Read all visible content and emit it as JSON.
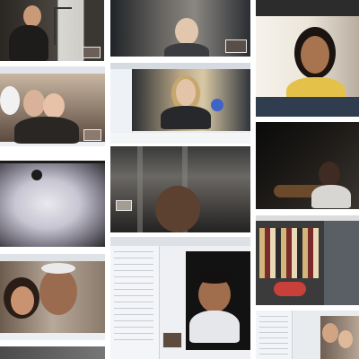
{
  "collage": {
    "tiles": [
      {
        "name": "tile-boy-whiteboard-call"
      },
      {
        "name": "tile-woman-dark-room-call"
      },
      {
        "name": "tile-woman-headphones-call"
      },
      {
        "name": "tile-couple-plush-toy-call"
      },
      {
        "name": "tile-blonde-woman-mac-window"
      },
      {
        "name": "tile-blurry-white-animal-call"
      },
      {
        "name": "tile-dim-ceiling-call"
      },
      {
        "name": "tile-dark-guitar-call"
      },
      {
        "name": "tile-girl-grandfather-call"
      },
      {
        "name": "tile-boy-chat-window"
      },
      {
        "name": "tile-photoshop-fabric-window"
      },
      {
        "name": "tile-two-boys-chat-window"
      },
      {
        "name": "tile-bottom-left-strip"
      }
    ]
  },
  "colors": {
    "background": "#ffffff",
    "call_frame": "#2b2b2b",
    "skype_blue": "#2c6fa6",
    "app_chrome": "#e9ecef"
  }
}
